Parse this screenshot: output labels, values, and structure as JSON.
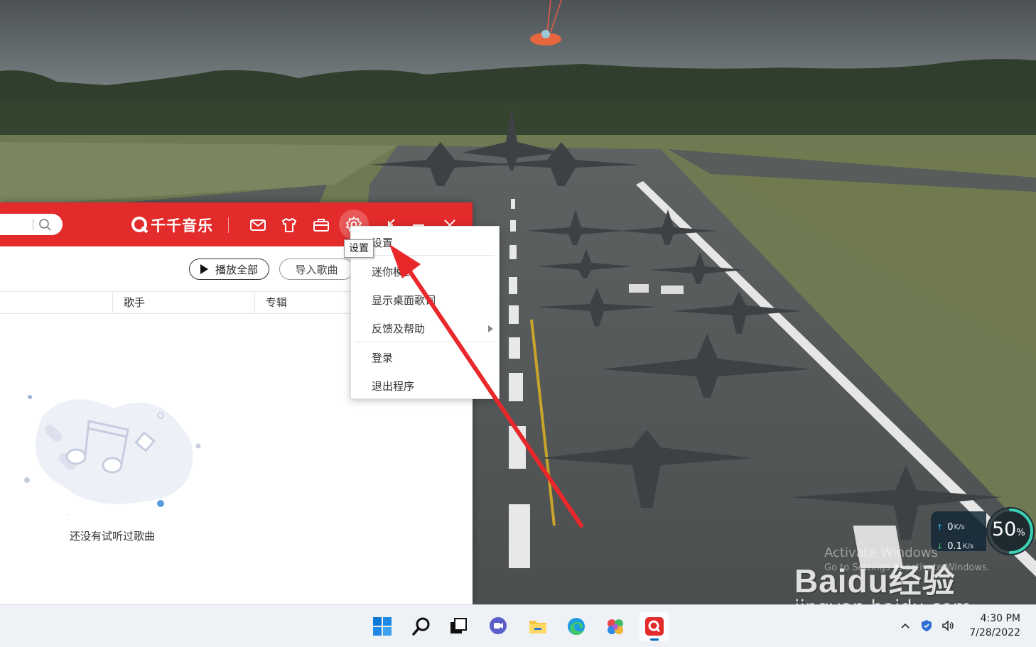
{
  "app": {
    "brand_name": "千千音乐",
    "buttons": {
      "play_all": "播放全部",
      "import_songs": "导入歌曲"
    },
    "columns": [
      "歌手",
      "专辑"
    ],
    "empty_message": "还没有试听过歌曲",
    "accent_color": "#e32b2b"
  },
  "tooltip": "设置",
  "settings_menu": {
    "items": [
      "设置",
      "迷你模式",
      "显示桌面歌词",
      "反馈及帮助",
      "登录",
      "退出程序"
    ]
  },
  "net_widget": {
    "upload": "0",
    "upload_unit": "K/s",
    "download": "0.1",
    "download_unit": "K/s",
    "percent": "50",
    "percent_sign": "%",
    "percent_value": 50
  },
  "watermark": {
    "activate_title": "Activate Windows",
    "activate_sub": "Go to Settings to activate Windows.",
    "baidu_logo": "Baidu经验",
    "baidu_url": "jingyan.baidu.com"
  },
  "taskbar": {
    "time": "4:30 PM",
    "date": "7/28/2022",
    "apps": [
      "windows-start-icon",
      "search-icon",
      "task-view-icon",
      "chat-icon",
      "file-explorer-icon",
      "edge-icon",
      "photos-icon",
      "qianqian-music-icon"
    ]
  }
}
